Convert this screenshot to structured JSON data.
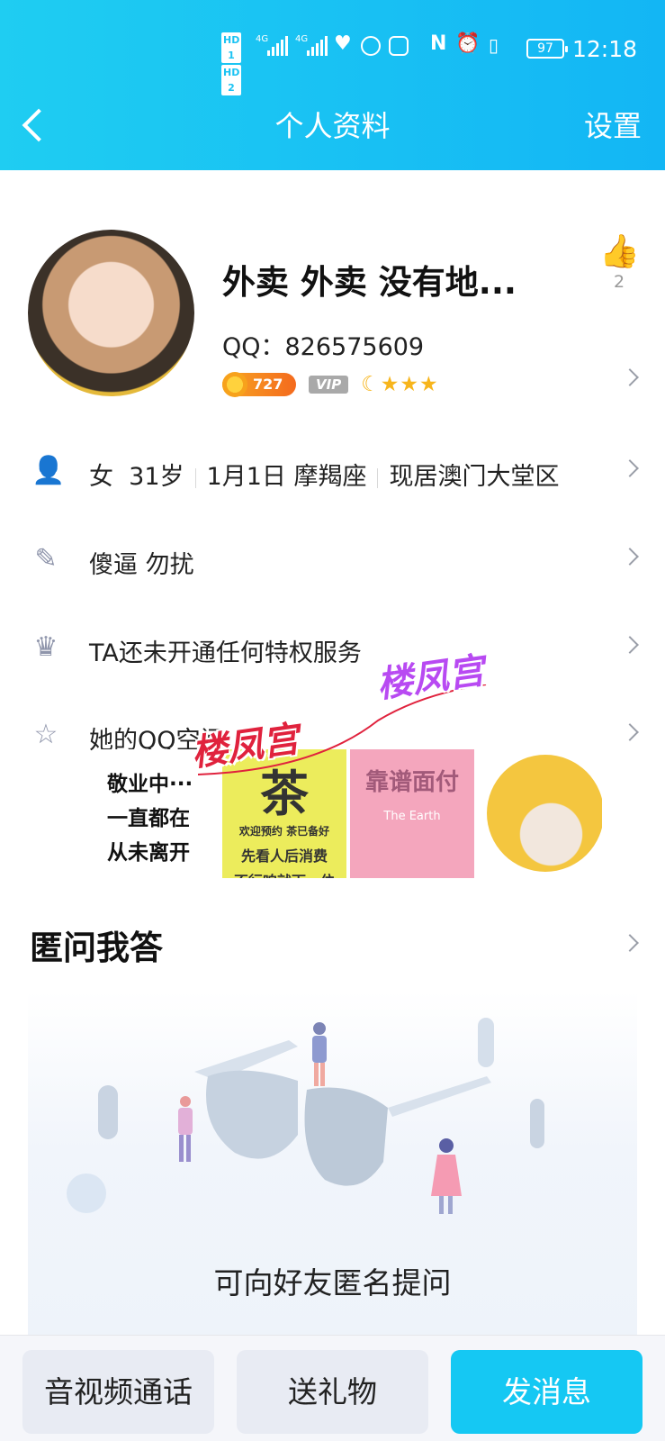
{
  "status_bar": {
    "hd1": "HD 1",
    "hd2": "HD 2",
    "net1": "4G",
    "net2": "4G",
    "battery": "97",
    "time": "12:18"
  },
  "nav": {
    "title": "个人资料",
    "settings": "设置"
  },
  "profile": {
    "nickname": "外卖 外卖 没有地...",
    "qq": "QQ：826575609",
    "coin_level": "727",
    "vip": "VIP",
    "like_count": "2"
  },
  "info_rows": {
    "basic": [
      "女",
      "31岁",
      "1月1日  摩羯座",
      "现居澳门大堂区"
    ],
    "signature": "傻逼 勿扰",
    "privilege": "TA还未开通任何特权服务",
    "qzone": "她的QQ空间"
  },
  "zone_photos": {
    "p1_lines": [
      "敬业中···",
      "一直都在",
      "从未离开"
    ],
    "p2_top": "欢迎预约  茶已备好",
    "p2_lines": [
      "先看人后消费",
      "不行咱就下一位"
    ],
    "p3_title": "靠谱面付",
    "p3_sub": "The Earth"
  },
  "watermark": "楼凤宫",
  "anon_qa": {
    "title": "匿问我答",
    "prompt": "可向好友匿名提问"
  },
  "actions": {
    "call": "音视频通话",
    "gift": "送礼物",
    "message": "发消息"
  },
  "colors": {
    "header": "#13b6f4",
    "primary_button": "#15c8f3",
    "watermark_red": "#e0223d",
    "watermark_purple": "#b84af2"
  }
}
